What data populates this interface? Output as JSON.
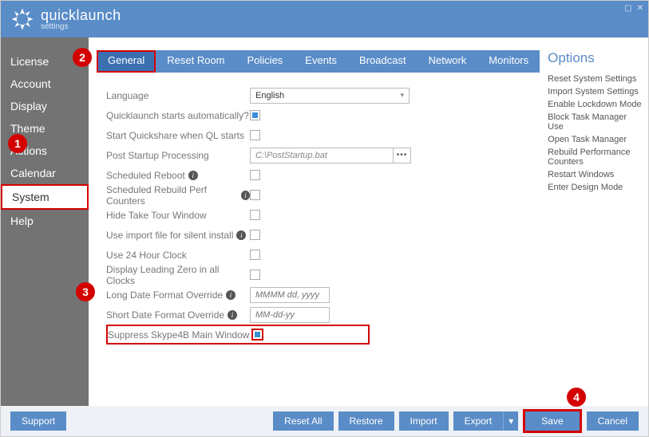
{
  "app": {
    "title_bold": "quick",
    "title_light": "launch",
    "subtitle": "settings"
  },
  "win": {
    "max": "▢",
    "close": "✕"
  },
  "sidebar": {
    "items": [
      {
        "label": "License"
      },
      {
        "label": "Account"
      },
      {
        "label": "Display"
      },
      {
        "label": "Theme"
      },
      {
        "label": "Actions"
      },
      {
        "label": "Calendar"
      },
      {
        "label": "System"
      },
      {
        "label": "Help"
      }
    ]
  },
  "tabs": [
    {
      "label": "General"
    },
    {
      "label": "Reset Room"
    },
    {
      "label": "Policies"
    },
    {
      "label": "Events"
    },
    {
      "label": "Broadcast"
    },
    {
      "label": "Network"
    },
    {
      "label": "Monitors"
    }
  ],
  "form": {
    "language_label": "Language",
    "language_value": "English",
    "autostart_label": "Quicklaunch starts automatically?",
    "quickshare_label": "Start Quickshare when QL starts",
    "poststartup_label": "Post Startup Processing",
    "poststartup_value": "C:\\PostStartup.bat",
    "sched_reboot_label": "Scheduled Reboot",
    "sched_rebuild_label": "Scheduled Rebuild Perf Counters",
    "hide_tour_label": "Hide Take Tour Window",
    "import_silent_label": "Use import file for silent install",
    "clock24_label": "Use 24 Hour Clock",
    "leading_zero_label": "Display Leading Zero in all Clocks",
    "long_date_label": "Long Date Format Override",
    "long_date_ph": "MMMM dd, yyyy",
    "short_date_label": "Short Date Format Override",
    "short_date_ph": "MM-dd-yy",
    "suppress_label": "Suppress Skype4B Main Window"
  },
  "options": {
    "title": "Options",
    "items": [
      "Reset System Settings",
      "Import System Settings",
      "Enable Lockdown Mode",
      "Block Task Manager Use",
      "Open Task Manager",
      "Rebuild Performance Counters",
      "Restart Windows",
      "Enter Design Mode"
    ]
  },
  "footer": {
    "support": "Support",
    "reset_all": "Reset All",
    "restore": "Restore",
    "import": "Import",
    "export": "Export",
    "save": "Save",
    "cancel": "Cancel"
  },
  "callouts": {
    "c1": "1",
    "c2": "2",
    "c3": "3",
    "c4": "4"
  }
}
